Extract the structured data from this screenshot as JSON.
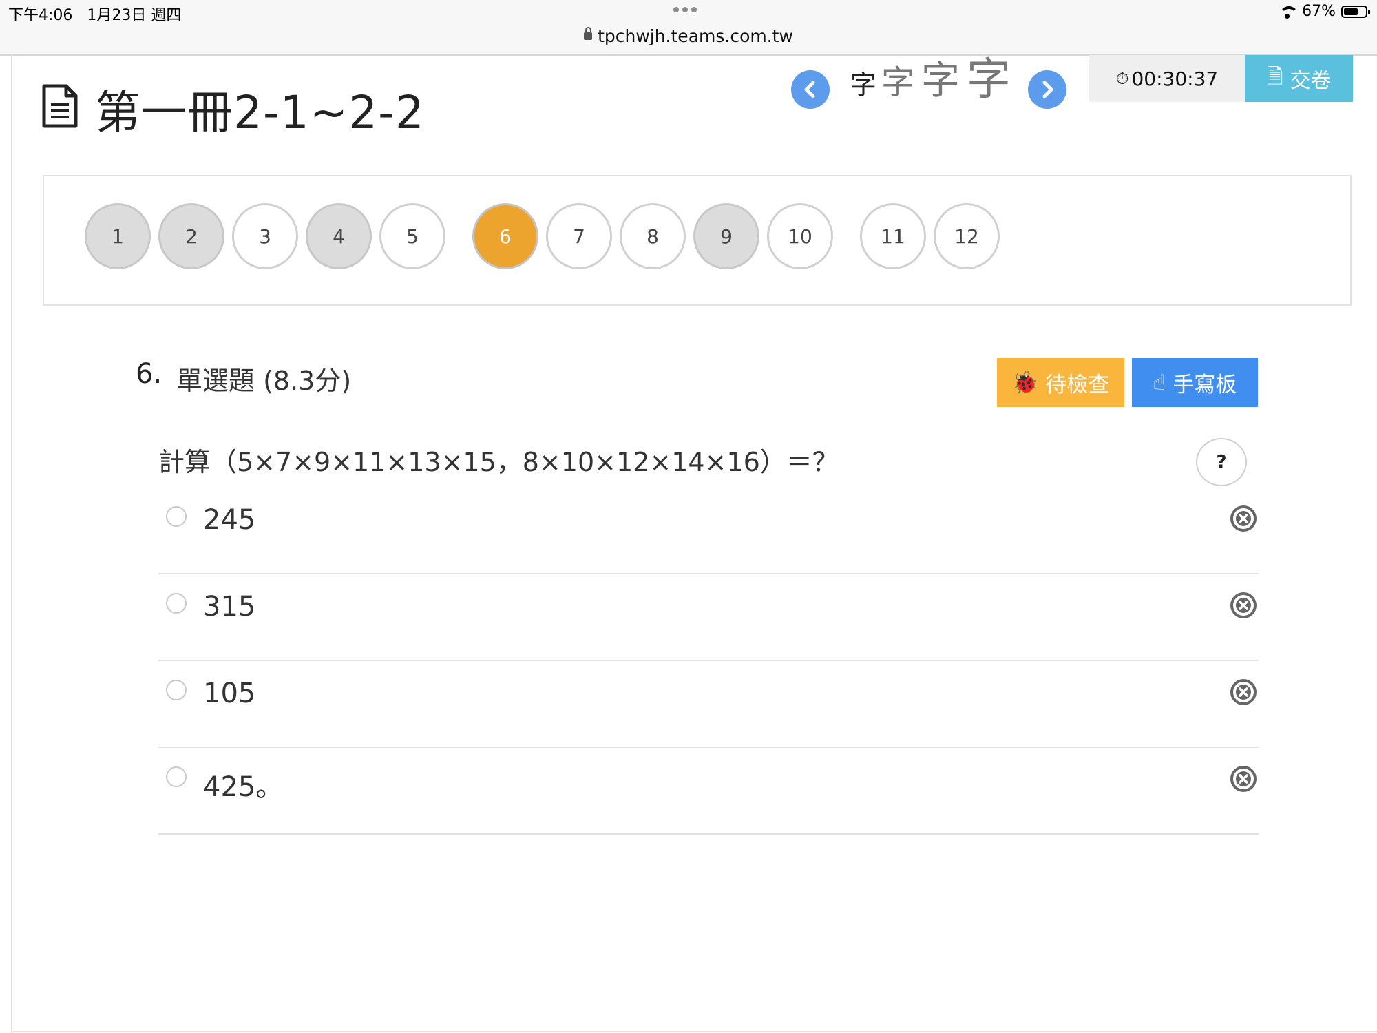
{
  "status_bar": {
    "time": "下午4:06",
    "date": "1月23日 週四",
    "url": "tpchwjh.teams.com.tw",
    "battery_percent": "67%",
    "battery_level": 0.67
  },
  "header": {
    "title": "第一冊2-1~2-2",
    "font_size_glyph": "字",
    "timer": "00:30:37",
    "submit_label": "交卷"
  },
  "pager": {
    "questions": [
      {
        "label": "1",
        "state": "answered"
      },
      {
        "label": "2",
        "state": "answered"
      },
      {
        "label": "3",
        "state": "unanswered"
      },
      {
        "label": "4",
        "state": "answered"
      },
      {
        "label": "5",
        "state": "unanswered"
      },
      {
        "label": "6",
        "state": "current"
      },
      {
        "label": "7",
        "state": "unanswered"
      },
      {
        "label": "8",
        "state": "unanswered"
      },
      {
        "label": "9",
        "state": "answered"
      },
      {
        "label": "10",
        "state": "unanswered"
      },
      {
        "label": "11",
        "state": "unanswered"
      },
      {
        "label": "12",
        "state": "unanswered"
      }
    ]
  },
  "question": {
    "number": "6.",
    "type": "單選題 (8.3分)",
    "review_label": "待檢查",
    "handwriting_label": "手寫板",
    "stem": "計算（5×7×9×11×13×15，8×10×12×14×16）＝？",
    "help_label": "?",
    "options": [
      "245",
      "315",
      "105",
      "425。"
    ]
  },
  "colors": {
    "current": "#eca42f",
    "answered": "#dcdcdc",
    "nav": "#5d9cec",
    "submit": "#5bc0de",
    "review": "#f9b53c",
    "handwriting": "#3f8ef0"
  }
}
